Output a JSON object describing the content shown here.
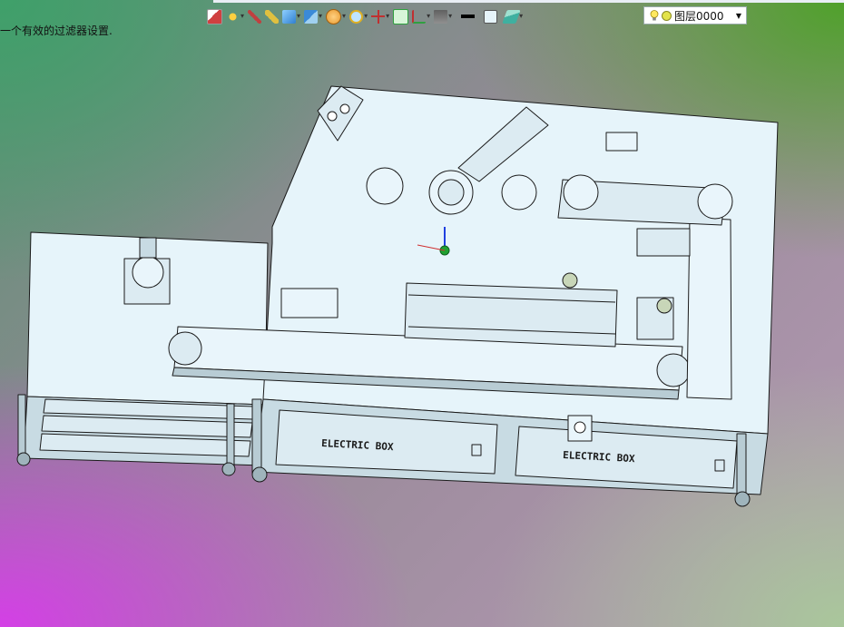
{
  "status_message": "一个有效的过滤器设置.",
  "toolbar": {
    "buttons": [
      {
        "icon": "insert-icon",
        "color": "#d04040"
      },
      {
        "icon": "light-icon",
        "color": "#e0a020"
      },
      {
        "icon": "pen-icon",
        "color": "#c04040"
      },
      {
        "icon": "pencil-icon",
        "color": "#e0c040"
      },
      {
        "icon": "cube-icon",
        "color": "#2f7fd0"
      },
      {
        "icon": "box-view-icon",
        "color": "#3a8ad8"
      },
      {
        "icon": "render-icon",
        "color": "#e89a30"
      },
      {
        "icon": "zoom-icon",
        "color": "#e0b020"
      },
      {
        "icon": "axis-icon",
        "color": "#c03030"
      },
      {
        "icon": "grid-icon",
        "color": "#30a040"
      },
      {
        "icon": "plane-icon",
        "color": "#30a040"
      },
      {
        "icon": "monitor-icon",
        "color": "#606060"
      },
      {
        "icon": "line-icon",
        "color": "#000000"
      },
      {
        "icon": "color-swatch-icon",
        "color": "#e6f4fa"
      },
      {
        "icon": "layers-icon",
        "color": "#3fb0a0"
      }
    ]
  },
  "layer": {
    "current": "图层0000"
  },
  "model": {
    "label_left": "ELECTRIC BOX",
    "label_right": "ELECTRIC BOX",
    "body_color": "#e6f4fa",
    "edge_color": "#1a1a1a"
  }
}
